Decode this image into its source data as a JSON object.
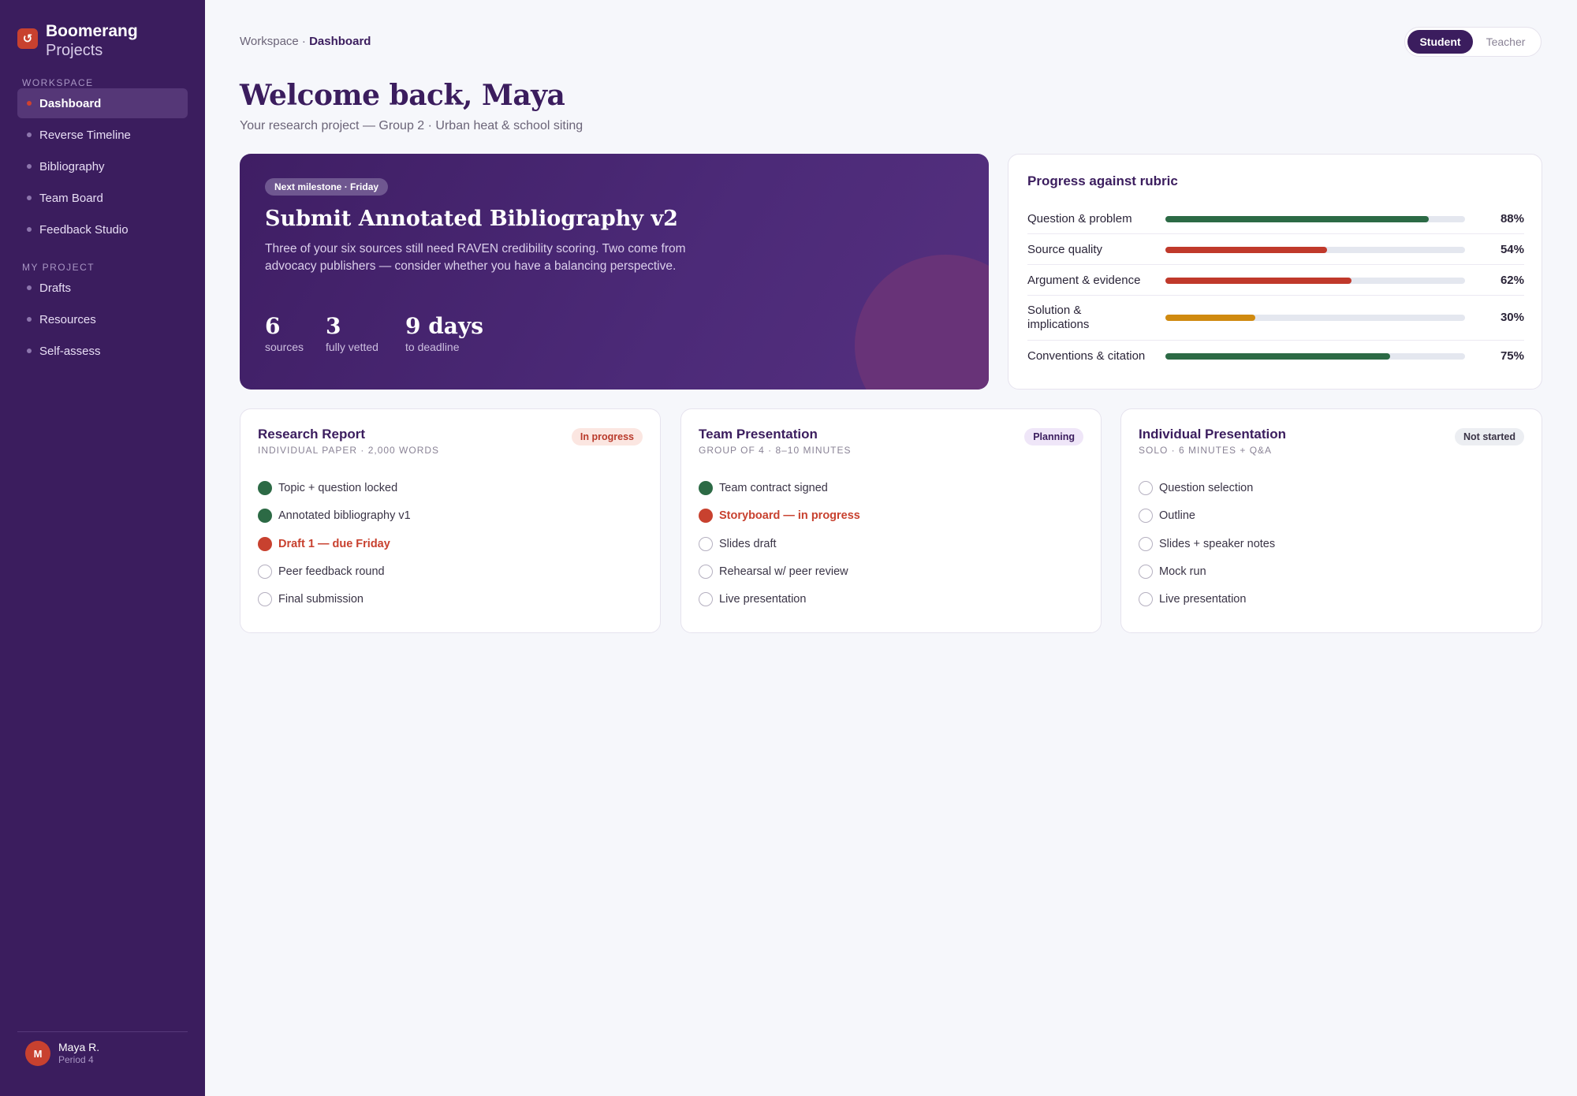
{
  "brand": {
    "mark": "↺",
    "name": "Boomerang",
    "sub": "Projects"
  },
  "sidebar": {
    "workspace_label": "Workspace",
    "workspace_items": [
      {
        "label": "Dashboard",
        "active": true
      },
      {
        "label": "Reverse Timeline"
      },
      {
        "label": "Bibliography"
      },
      {
        "label": "Team Board"
      },
      {
        "label": "Feedback Studio"
      }
    ],
    "project_label": "My Project",
    "project_items": [
      {
        "label": "Drafts"
      },
      {
        "label": "Resources"
      },
      {
        "label": "Self-assess"
      }
    ],
    "user": {
      "initial": "M",
      "name": "Maya R.",
      "period": "Period 4"
    }
  },
  "header": {
    "breadcrumb_root": "Workspace ·",
    "breadcrumb_current": "Dashboard",
    "role_student": "Student",
    "role_teacher": "Teacher",
    "title": "Welcome back, Maya",
    "subtitle": "Your research project — Group 2 · Urban heat & school siting"
  },
  "hero": {
    "pill": "Next milestone · Friday",
    "title": "Submit Annotated Bibliography v2",
    "description": "Three of your six sources still need RAVEN credibility scoring. Two come from advocacy publishers — consider whether you have a balancing perspective.",
    "stats": [
      {
        "value": "6",
        "label": "sources"
      },
      {
        "value": "3",
        "label": "fully vetted"
      },
      {
        "value": "9 days",
        "label": "to deadline"
      }
    ]
  },
  "rubric": {
    "title": "Progress against rubric",
    "colors": {
      "green": "#2c6a45",
      "red": "#c0392b",
      "amber": "#d08a10"
    },
    "rows": [
      {
        "label": "Question & problem",
        "value": 88,
        "pct": "88%",
        "color": "green"
      },
      {
        "label": "Source quality",
        "value": 54,
        "pct": "54%",
        "color": "red"
      },
      {
        "label": "Argument & evidence",
        "value": 62,
        "pct": "62%",
        "color": "red"
      },
      {
        "label": "Solution & implications",
        "value": 30,
        "pct": "30%",
        "color": "amber"
      },
      {
        "label": "Conventions & citation",
        "value": 75,
        "pct": "75%",
        "color": "green"
      }
    ]
  },
  "cards": [
    {
      "title": "Research Report",
      "subtitle": "Individual paper · 2,000 words",
      "badge": "In progress",
      "badge_style": {
        "bg": "#fbe6e1",
        "fg": "#b93a2b"
      },
      "tasks": [
        {
          "label": "Topic + question locked",
          "state": "done"
        },
        {
          "label": "Annotated bibliography v1",
          "state": "done"
        },
        {
          "label": "Draft 1 — due Friday",
          "state": "active"
        },
        {
          "label": "Peer feedback round",
          "state": "todo"
        },
        {
          "label": "Final submission",
          "state": "todo"
        }
      ]
    },
    {
      "title": "Team Presentation",
      "subtitle": "Group of 4 · 8–10 minutes",
      "badge": "Planning",
      "badge_style": {
        "bg": "#efe6f8",
        "fg": "#3b1d5e"
      },
      "tasks": [
        {
          "label": "Team contract signed",
          "state": "done"
        },
        {
          "label": "Storyboard — in progress",
          "state": "active"
        },
        {
          "label": "Slides draft",
          "state": "todo"
        },
        {
          "label": "Rehearsal w/ peer review",
          "state": "todo"
        },
        {
          "label": "Live presentation",
          "state": "todo"
        }
      ]
    },
    {
      "title": "Individual Presentation",
      "subtitle": "Solo · 6 minutes + Q&A",
      "badge": "Not started",
      "badge_style": {
        "bg": "#eceef2",
        "fg": "#3a3446"
      },
      "tasks": [
        {
          "label": "Question selection",
          "state": "todo"
        },
        {
          "label": "Outline",
          "state": "todo"
        },
        {
          "label": "Slides + speaker notes",
          "state": "todo"
        },
        {
          "label": "Mock run",
          "state": "todo"
        },
        {
          "label": "Live presentation",
          "state": "todo"
        }
      ]
    }
  ]
}
